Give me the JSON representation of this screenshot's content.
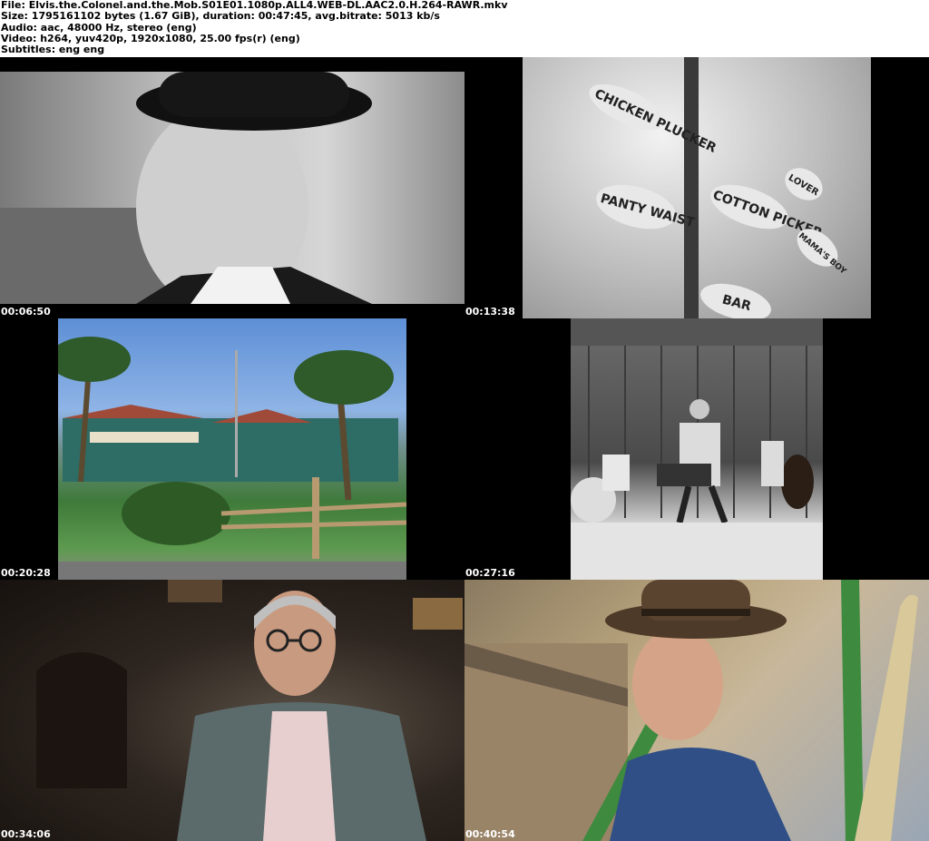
{
  "header": {
    "file": "File: Elvis.the.Colonel.and.the.Mob.S01E01.1080p.ALL4.WEB-DL.AAC2.0.H.264-RAWR.mkv",
    "size": "Size: 1795161102 bytes (1.67 GiB), duration: 00:47:45, avg.bitrate: 5013 kb/s",
    "audio": "Audio: aac, 48000 Hz, stereo (eng)",
    "video": "Video: h264, yuv420p, 1920x1080, 25.00 fps(r) (eng)",
    "subtitles": "Subtitles: eng eng"
  },
  "thumbnails": [
    {
      "timestamp": "00:06:50",
      "alt": "man in hat, black and white"
    },
    {
      "timestamp": "00:13:38",
      "alt": "signpost, black and white"
    },
    {
      "timestamp": "00:20:28",
      "alt": "motel with palm trees, color"
    },
    {
      "timestamp": "00:27:16",
      "alt": "performer on stage with band, black and white"
    },
    {
      "timestamp": "00:34:06",
      "alt": "man with glasses interview"
    },
    {
      "timestamp": "00:40:54",
      "alt": "man in cowboy hat, color"
    }
  ],
  "sign_texts": [
    "PANTY WAIST",
    "COTTON PICKER",
    "CHICKEN PLUCKER",
    "BAR",
    "LOVER",
    "MAMA'S BOY"
  ]
}
